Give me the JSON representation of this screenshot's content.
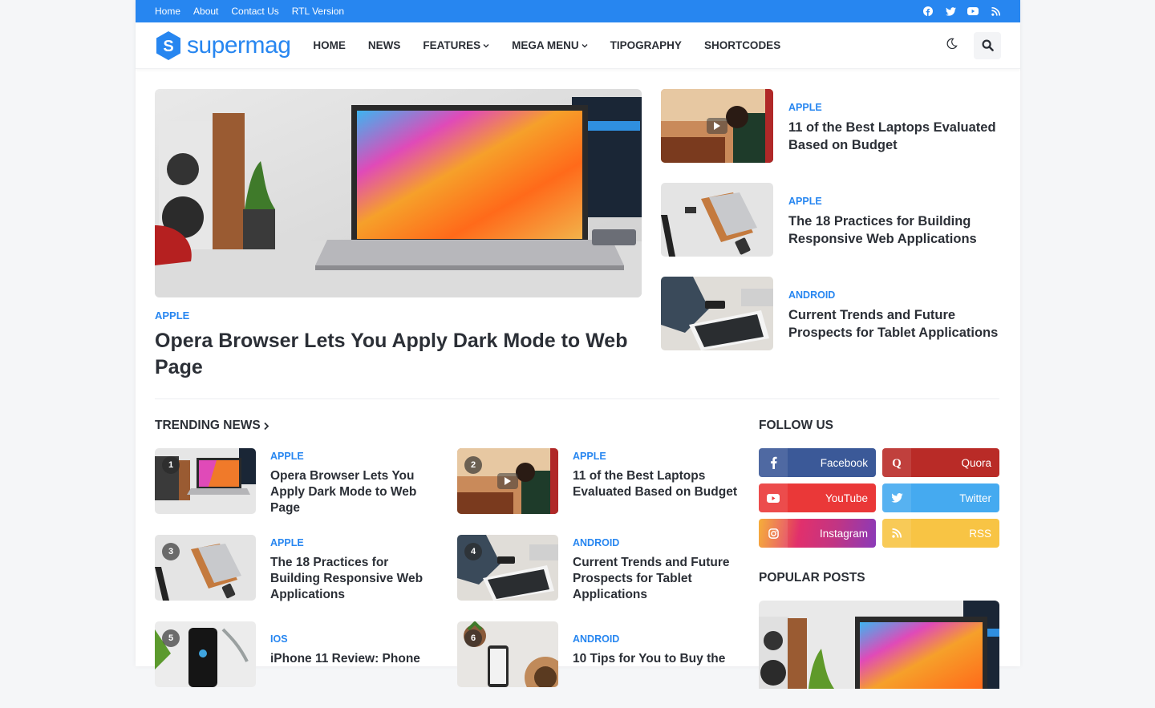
{
  "topbar": {
    "links": [
      "Home",
      "About",
      "Contact Us",
      "RTL Version"
    ],
    "social_icons": [
      "facebook-icon",
      "twitter-icon",
      "youtube-icon",
      "rss-icon"
    ]
  },
  "header": {
    "logo_letter": "S",
    "logo_text": "supermag",
    "nav": [
      {
        "label": "HOME",
        "dropdown": false
      },
      {
        "label": "NEWS",
        "dropdown": false
      },
      {
        "label": "FEATURES",
        "dropdown": true
      },
      {
        "label": "MEGA MENU",
        "dropdown": true
      },
      {
        "label": "TIPOGRAPHY",
        "dropdown": false
      },
      {
        "label": "SHORTCODES",
        "dropdown": false
      }
    ],
    "dark_mode_icon": "moon-icon",
    "search_icon": "search-icon"
  },
  "hero": {
    "category": "APPLE",
    "title": "Opera Browser Lets You Apply Dark Mode to Web Page"
  },
  "side_posts": [
    {
      "category": "APPLE",
      "title": "11 of the Best Laptops Evaluated Based on Budget",
      "video": true
    },
    {
      "category": "APPLE",
      "title": "The 18 Practices for Building Responsive Web Applications",
      "video": false
    },
    {
      "category": "ANDROID",
      "title": "Current Trends and Future Prospects for Tablet Applications",
      "video": false
    }
  ],
  "trending": {
    "title": "TRENDING NEWS",
    "items": [
      {
        "num": "1",
        "category": "APPLE",
        "title": "Opera Browser Lets You Apply Dark Mode to Web Page"
      },
      {
        "num": "2",
        "category": "APPLE",
        "title": "11 of the Best Laptops Evaluated Based on Budget"
      },
      {
        "num": "3",
        "category": "APPLE",
        "title": "The 18 Practices for Building Responsive Web Applications"
      },
      {
        "num": "4",
        "category": "ANDROID",
        "title": "Current Trends and Future Prospects for Tablet Applications"
      },
      {
        "num": "5",
        "category": "IOS",
        "title": "iPhone 11 Review: Phone"
      },
      {
        "num": "6",
        "category": "ANDROID",
        "title": "10 Tips for You to Buy the"
      }
    ]
  },
  "follow": {
    "title": "FOLLOW US",
    "networks": [
      {
        "label": "Facebook",
        "color": "#3b5998"
      },
      {
        "label": "Quora",
        "color": "#b92b27"
      },
      {
        "label": "YouTube",
        "color": "#ea3838"
      },
      {
        "label": "Twitter",
        "color": "#45aaf0"
      },
      {
        "label": "Instagram",
        "color": "#c13584"
      },
      {
        "label": "RSS",
        "color": "#f8c444"
      }
    ]
  },
  "popular": {
    "title": "POPULAR POSTS"
  },
  "colors": {
    "accent": "#2786f0",
    "text": "#2b2f36"
  }
}
